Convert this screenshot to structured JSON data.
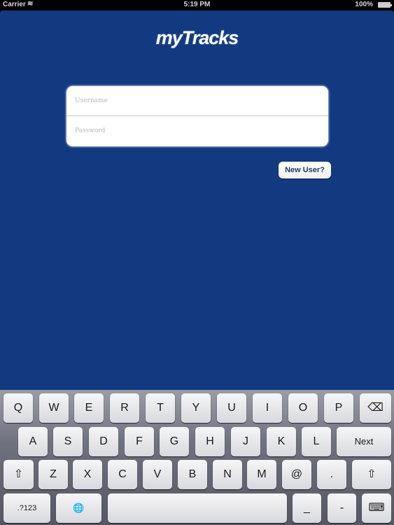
{
  "status_bar": {
    "carrier": "Carrier",
    "wifi_icon": "≋",
    "time": "5:19 PM",
    "battery_percent": "100%"
  },
  "app": {
    "logo_text": "myTracks",
    "username_placeholder": "Username",
    "username_value": "",
    "password_placeholder": "Password",
    "password_value": "",
    "new_user_label": "New User?"
  },
  "keyboard": {
    "row1": [
      "Q",
      "W",
      "E",
      "R",
      "T",
      "Y",
      "U",
      "I",
      "O",
      "P"
    ],
    "backspace_icon": "⌫",
    "row2": [
      "A",
      "S",
      "D",
      "F",
      "G",
      "H",
      "J",
      "K",
      "L"
    ],
    "next_label": "Next",
    "shift_icon": "⇧",
    "row3": [
      "Z",
      "X",
      "C",
      "V",
      "B",
      "N",
      "M",
      "@",
      "."
    ],
    "numbers_label": ".?123",
    "globe_icon": "🌐",
    "space_label": "",
    "underscore_label": "_",
    "dash_label": "-",
    "dismiss_icon": "⌨"
  },
  "colors": {
    "background": "#133a80",
    "new_user_text": "#233a6c"
  }
}
